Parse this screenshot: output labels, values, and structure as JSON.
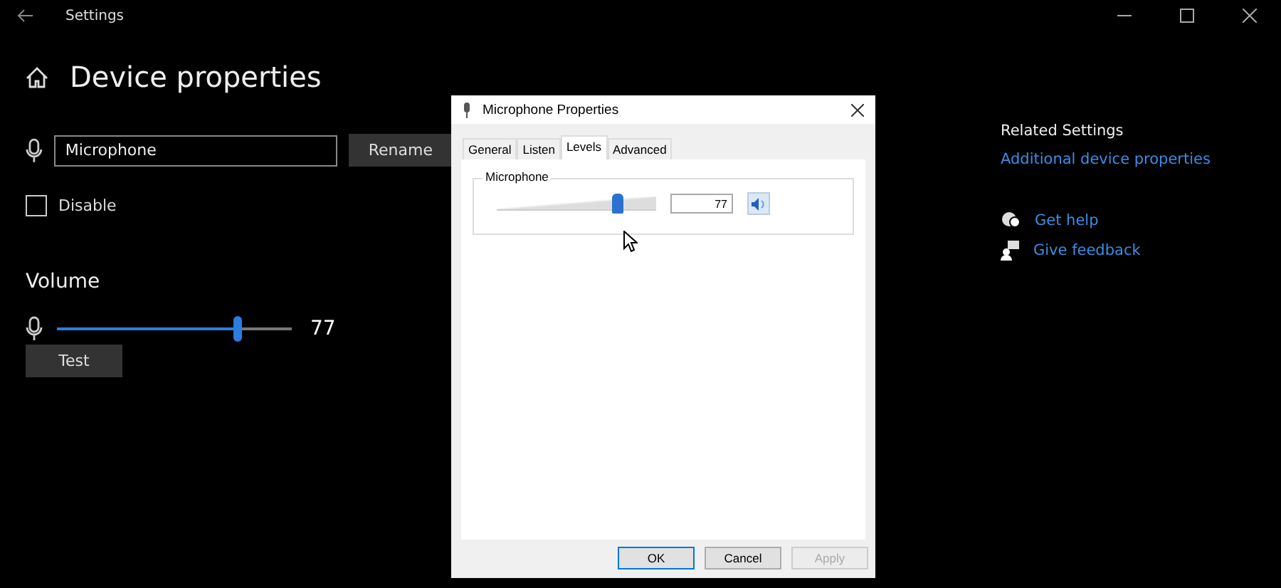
{
  "window": {
    "title": "Settings"
  },
  "page": {
    "title": "Device properties",
    "device_name": "Microphone",
    "rename_button": "Rename",
    "disable": {
      "label": "Disable",
      "checked": false
    },
    "volume": {
      "heading": "Volume",
      "level": 0.77,
      "reading": "77"
    },
    "test_button": "Test"
  },
  "related": {
    "heading": "Related Settings",
    "link": "Additional device properties",
    "help": [
      {
        "kind": "help",
        "label": "Get help"
      },
      {
        "kind": "feedback",
        "label": "Give feedback"
      }
    ]
  },
  "dialog": {
    "title": "Microphone Properties",
    "tabs": [
      {
        "label": "General",
        "selected": false
      },
      {
        "label": "Listen",
        "selected": false
      },
      {
        "label": "Levels",
        "selected": true
      },
      {
        "label": "Advanced",
        "selected": false
      }
    ],
    "group_label": "Microphone",
    "level": 0.77,
    "value": "77",
    "buttons": [
      {
        "label": "OK",
        "default": true,
        "disabled": false
      },
      {
        "label": "Cancel",
        "default": false,
        "disabled": false
      },
      {
        "label": "Apply",
        "default": false,
        "disabled": true
      }
    ]
  }
}
